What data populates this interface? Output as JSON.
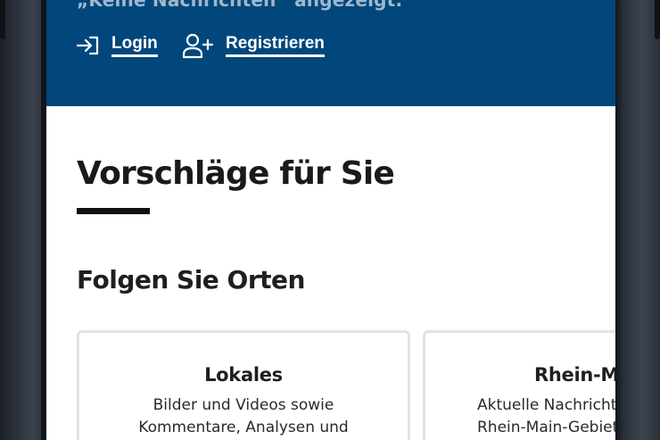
{
  "header": {
    "partial_text": "„Keine Nachrichten“ angezeigt.",
    "login_label": "Login",
    "register_label": "Registrieren",
    "background_color": "#02477b"
  },
  "main": {
    "title": "Vorschläge für Sie",
    "subtitle": "Folgen Sie Orten",
    "cards": [
      {
        "title": "Lokales",
        "lines": [
          "Bilder und Videos sowie",
          "Kommentare, Analysen und"
        ]
      },
      {
        "title": "Rhein-M",
        "lines": [
          "Aktuelle Nachricht",
          "Rhein-Main-Gebiet"
        ]
      }
    ]
  },
  "icons": {
    "login": "login-arrow-icon",
    "register": "user-plus-icon"
  }
}
